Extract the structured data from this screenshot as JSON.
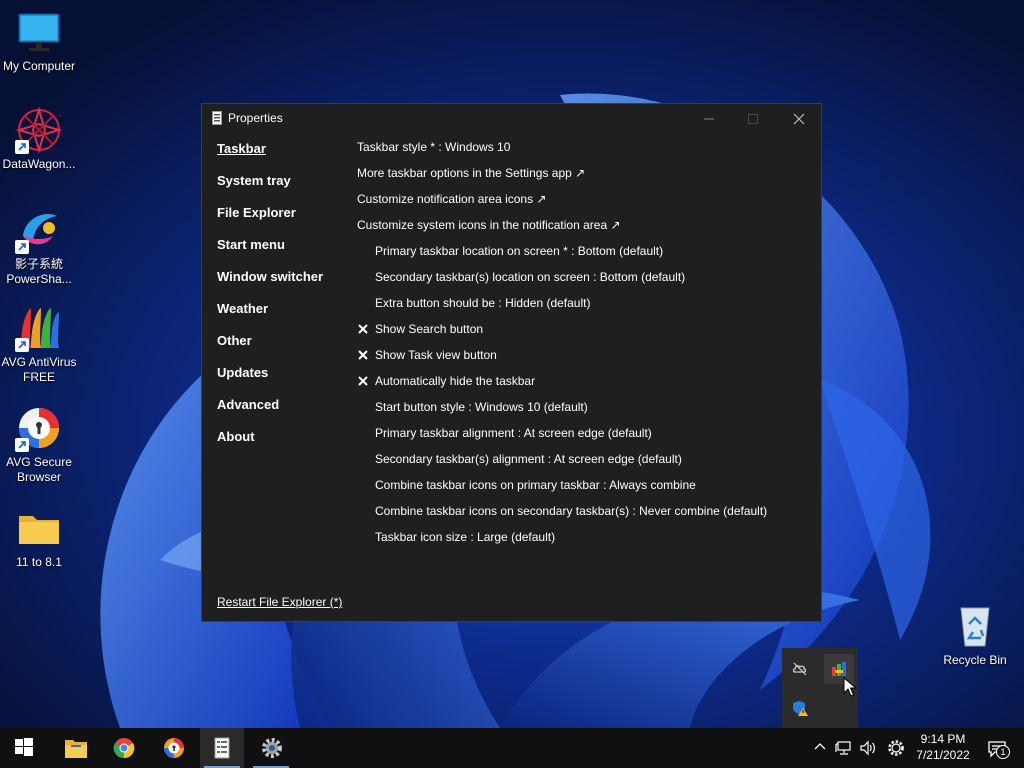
{
  "desktop": {
    "icons": [
      {
        "label": "My Computer"
      },
      {
        "label": "DataWagon..."
      },
      {
        "label_line1": "影子系統",
        "label_line2": "PowerSha..."
      },
      {
        "label_line1": "AVG AntiVirus",
        "label_line2": "FREE"
      },
      {
        "label_line1": "AVG Secure",
        "label_line2": "Browser"
      },
      {
        "label": "11 to 8.1"
      },
      {
        "label": "Recycle Bin"
      }
    ]
  },
  "window": {
    "title": "Properties",
    "nav": [
      {
        "label": "Taskbar"
      },
      {
        "label": "System tray"
      },
      {
        "label": "File Explorer"
      },
      {
        "label": "Start menu"
      },
      {
        "label": "Window switcher"
      },
      {
        "label": "Weather"
      },
      {
        "label": "Other"
      },
      {
        "label": "Updates"
      },
      {
        "label": "Advanced"
      },
      {
        "label": "About"
      }
    ],
    "options": [
      {
        "label": "Taskbar style * : Windows 10"
      },
      {
        "label": "More taskbar options in the Settings app ↗"
      },
      {
        "label": "Customize notification area icons ↗"
      },
      {
        "label": "Customize system icons in the notification area ↗"
      },
      {
        "label": "Primary taskbar location on screen * : Bottom (default)"
      },
      {
        "label": "Secondary taskbar(s) location on screen : Bottom (default)"
      },
      {
        "label": "Extra button should be : Hidden (default)"
      },
      {
        "label": "Show Search button"
      },
      {
        "label": "Show Task view button"
      },
      {
        "label": "Automatically hide the taskbar"
      },
      {
        "label": "Start button style : Windows 10 (default)"
      },
      {
        "label": "Primary taskbar alignment : At screen edge (default)"
      },
      {
        "label": "Secondary taskbar(s) alignment : At screen edge (default)"
      },
      {
        "label": "Combine taskbar icons on primary taskbar : Always combine"
      },
      {
        "label": "Combine taskbar icons on secondary taskbar(s) : Never combine (default)"
      },
      {
        "label": "Taskbar icon size : Large (default)"
      }
    ],
    "restart_label": "Restart File Explorer (*)"
  },
  "taskbar": {
    "time": "9:14 PM",
    "date": "7/21/2022",
    "notification_count": "1"
  },
  "colors": {
    "window_bg": "#1f1f1f",
    "taskbar_bg": "#101010",
    "accent": "#2a5bd7"
  }
}
